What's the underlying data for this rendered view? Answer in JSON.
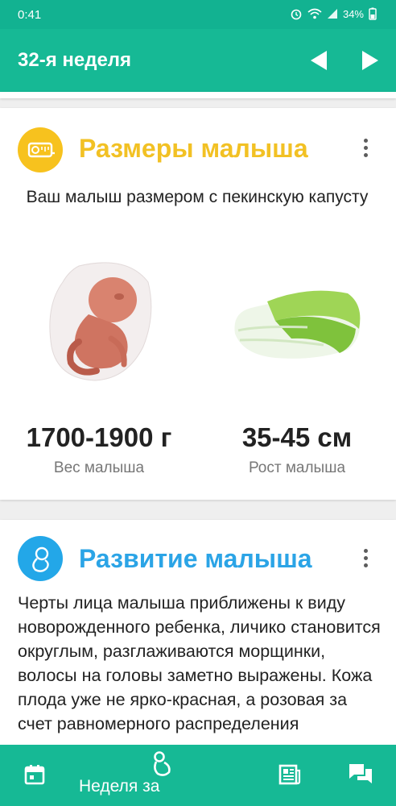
{
  "status_bar": {
    "time": "0:41",
    "battery": "34%",
    "icons": [
      "alarm-icon",
      "wifi-icon",
      "signal-icon",
      "battery-icon"
    ]
  },
  "app_bar": {
    "title": "32-я неделя",
    "prev_icon": "triangle-left-icon",
    "next_icon": "triangle-right-icon"
  },
  "size_card": {
    "title": "Размеры малыша",
    "icon": "measuring-tape-icon",
    "subtitle": "Ваш малыш размером с пекинскую капусту",
    "weight_value": "1700-1900 г",
    "weight_label": "Вес малыша",
    "height_value": "35-45 см",
    "height_label": "Рост малыша",
    "accent": "#f2c124"
  },
  "dev_card": {
    "title": "Развитие малыша",
    "icon": "fetus-icon",
    "text": "Черты лица малыша приближены к виду новорожденного ребенка, личико становится округлым, разглаживаются морщинки, волосы на головы заметно выражены. Кожа плода уже не ярко-красная, а розовая за счет равномерного распределения",
    "accent": "#2ba4e6"
  },
  "bottom_nav": {
    "calendar_icon": "calendar-icon",
    "week_label": "Неделя за",
    "week_icon": "baby-icon",
    "news_icon": "newspaper-icon",
    "chat_icon": "chat-icon"
  },
  "colors": {
    "primary": "#16b995",
    "status": "#12b291"
  }
}
